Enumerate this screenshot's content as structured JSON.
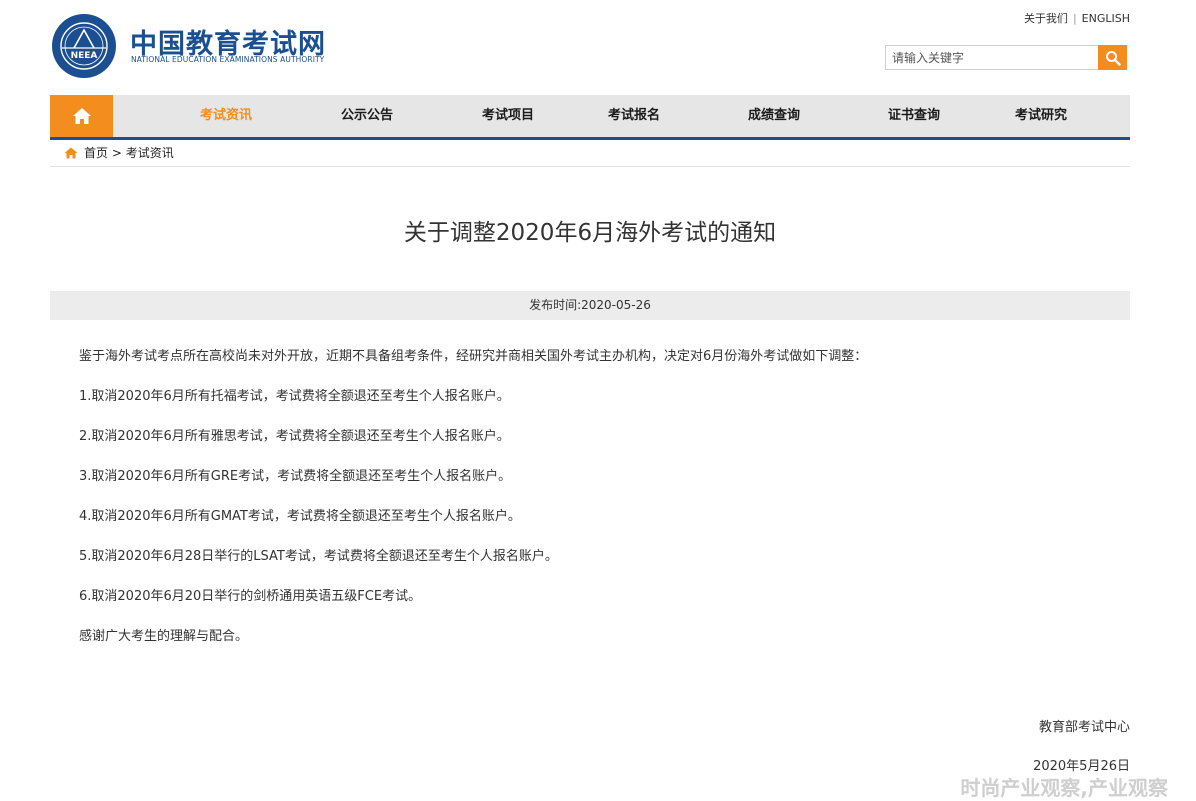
{
  "header": {
    "top_links": [
      "关于我们",
      "ENGLISH"
    ],
    "top_links_separator": "|",
    "logo_text": "NEEA",
    "site_name": "中国教育考试网",
    "site_name_en": "NATIONAL EDUCATION EXAMINATIONS AUTHORITY",
    "search_placeholder": "请输入关键字",
    "search_icon": "magnifier-icon"
  },
  "nav": {
    "home_icon": "home-icon",
    "items": [
      "考试资讯",
      "公示公告",
      "考试项目",
      "考试报名",
      "成绩查询",
      "证书查询",
      "考试研究"
    ],
    "active_index": 0
  },
  "breadcrumb": {
    "home": "首页",
    "separator": ">",
    "current": "考试资讯"
  },
  "article": {
    "title": "关于调整2020年6月海外考试的通知",
    "published_label": "发布时间:",
    "published_date": "2020-05-26",
    "paragraphs": [
      "鉴于海外考试考点所在高校尚未对外开放，近期不具备组考条件，经研究并商相关国外考试主办机构，决定对6月份海外考试做如下调整：",
      "1.取消2020年6月所有托福考试，考试费将全额退还至考生个人报名账户。",
      "2.取消2020年6月所有雅思考试，考试费将全额退还至考生个人报名账户。",
      "3.取消2020年6月所有GRE考试，考试费将全额退还至考生个人报名账户。",
      "4.取消2020年6月所有GMAT考试，考试费将全额退还至考生个人报名账户。",
      "5.取消2020年6月28日举行的LSAT考试，考试费将全额退还至考生个人报名账户。",
      "6.取消2020年6月20日举行的剑桥通用英语五级FCE考试。",
      "感谢广大考生的理解与配合。"
    ],
    "signature_org": "教育部考试中心",
    "signature_date": "2020年5月26日"
  },
  "watermark": "时尚产业观察,产业观察",
  "colors": {
    "brand_blue": "#1b4f91",
    "accent_orange": "#f28d1e",
    "nav_bg": "#e6e6e6",
    "dateline_bg": "#ececec"
  }
}
